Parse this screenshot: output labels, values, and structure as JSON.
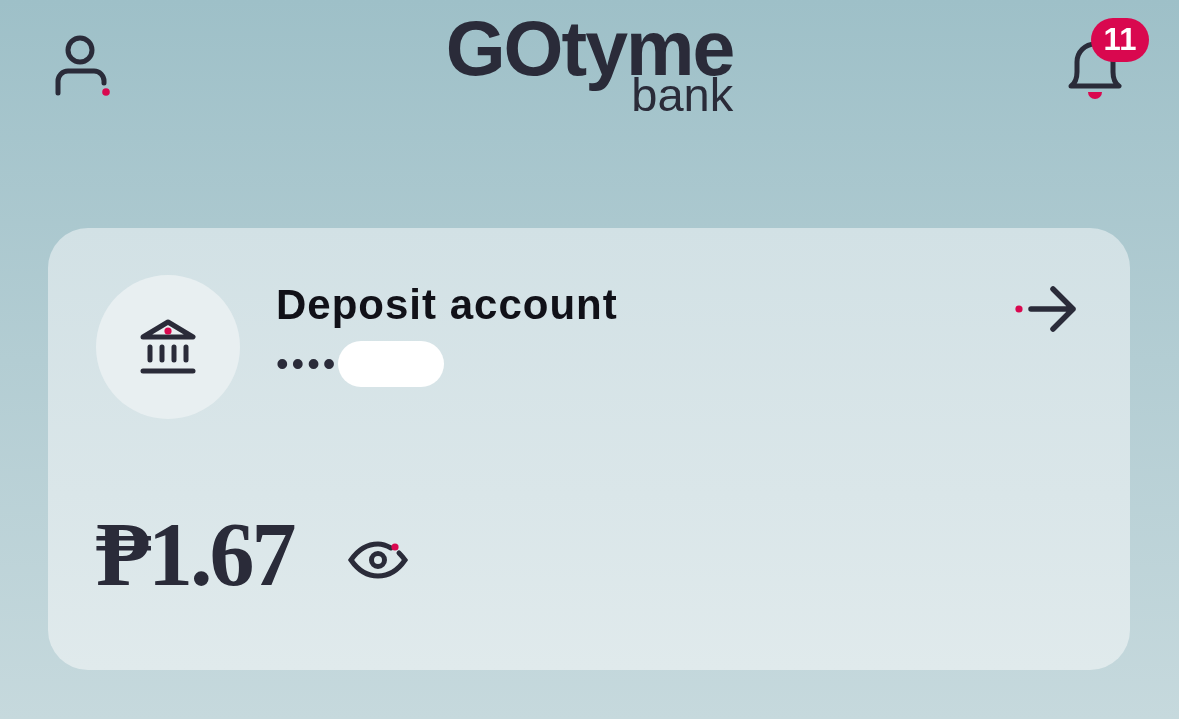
{
  "header": {
    "logo": {
      "wordmark": "GOtyme",
      "sub": "bank"
    },
    "notifications": {
      "badge": "11"
    }
  },
  "account_card": {
    "title": "Deposit account",
    "masked_number": "••••",
    "balance": "₱1.67"
  }
}
